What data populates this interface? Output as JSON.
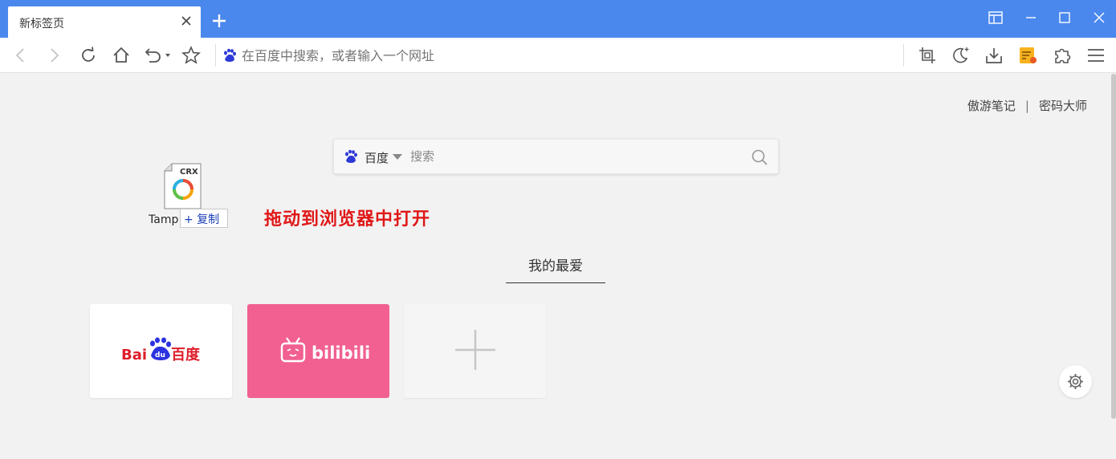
{
  "tab": {
    "title": "新标签页"
  },
  "toolbar": {
    "address_placeholder": "在百度中搜索，或者输入一个网址"
  },
  "top_links": {
    "notes": "傲游笔记",
    "separator": "|",
    "password": "密码大师"
  },
  "search": {
    "engine": "百度",
    "placeholder": "搜索"
  },
  "drag": {
    "file_badge": "CRX",
    "file_name": "Tamp",
    "copy_label": "+ 复制",
    "hint": "拖动到浏览器中打开"
  },
  "favorites": {
    "title": "我的最爱",
    "tiles": [
      {
        "name": "百度",
        "logo_text": "Bai",
        "logo_du": "du",
        "logo_cn": "百度",
        "bg": "#ffffff"
      },
      {
        "name": "bilibili",
        "logo_text": "bilibili",
        "bg": "#f16090"
      },
      {
        "name": "add"
      }
    ]
  },
  "colors": {
    "titlebar": "#4a88ee",
    "hint": "#e01818",
    "baidu_red": "#de1d2b",
    "baidu_blue": "#2b32e0"
  }
}
